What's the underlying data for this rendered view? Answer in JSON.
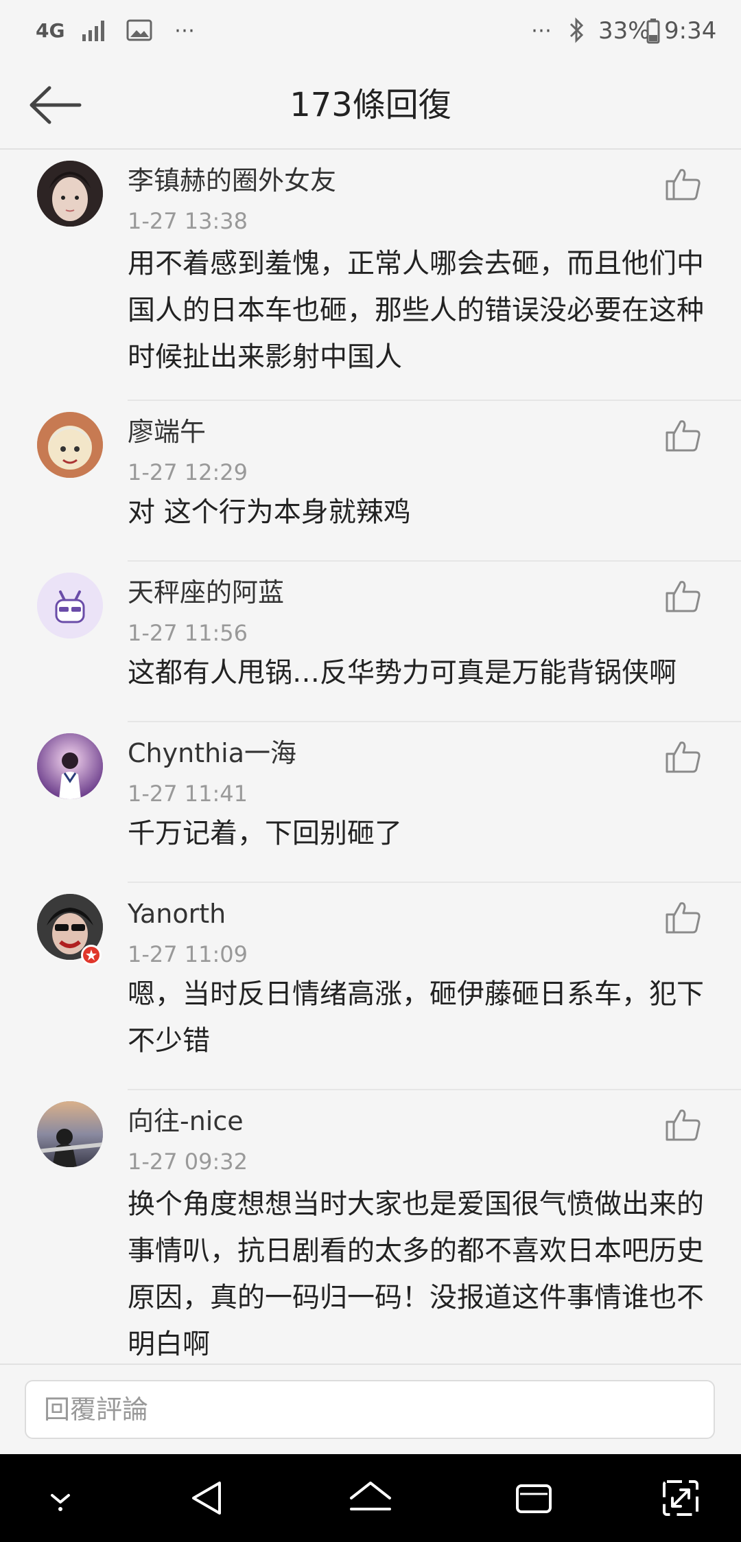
{
  "status_bar": {
    "network": "4G",
    "battery": "33%",
    "time": "9:34",
    "icons": [
      "network-4g-icon",
      "signal-icon",
      "image-icon",
      "more-dots-icon",
      "bluetooth-icon",
      "battery-icon"
    ]
  },
  "header": {
    "title": "173條回復",
    "back_icon": "back-arrow-icon"
  },
  "comments": [
    {
      "username": "李镇赫的圈外女友",
      "time": "1-27 13:38",
      "text": "用不着感到羞愧，正常人哪会去砸，而且他们中国人的日本车也砸，那些人的错误没必要在这种时候扯出来影射中国人"
    },
    {
      "username": "廖端午",
      "time": "1-27 12:29",
      "text": "对 这个行为本身就辣鸡"
    },
    {
      "username": "天秤座的阿蓝",
      "time": "1-27 11:56",
      "text": "这都有人甩锅…反华势力可真是万能背锅侠啊"
    },
    {
      "username": "Chynthia一海",
      "time": "1-27 11:41",
      "text": "千万记着，下回别砸了"
    },
    {
      "username": "Yanorth",
      "time": "1-27 11:09",
      "text": "嗯，当时反日情绪高涨，砸伊藤砸日系车，犯下不少错"
    },
    {
      "username": "向往-nice",
      "time": "1-27 09:32",
      "text": "换个角度想想当时大家也是爱国很气愤做出来的事情叭，抗日剧看的太多的都不喜欢日本吧历史原因，真的一码归一码！没报道这件事情谁也不明白啊"
    }
  ],
  "reply": {
    "placeholder": "回覆評論"
  },
  "nav_bar": {
    "icons": [
      "hide-keyboard-icon",
      "back-icon",
      "home-icon",
      "recents-icon",
      "fullscreen-icon"
    ]
  },
  "colors": {
    "background": "#f5f5f5",
    "text": "#222222",
    "muted": "#999999",
    "nav": "#000000"
  }
}
